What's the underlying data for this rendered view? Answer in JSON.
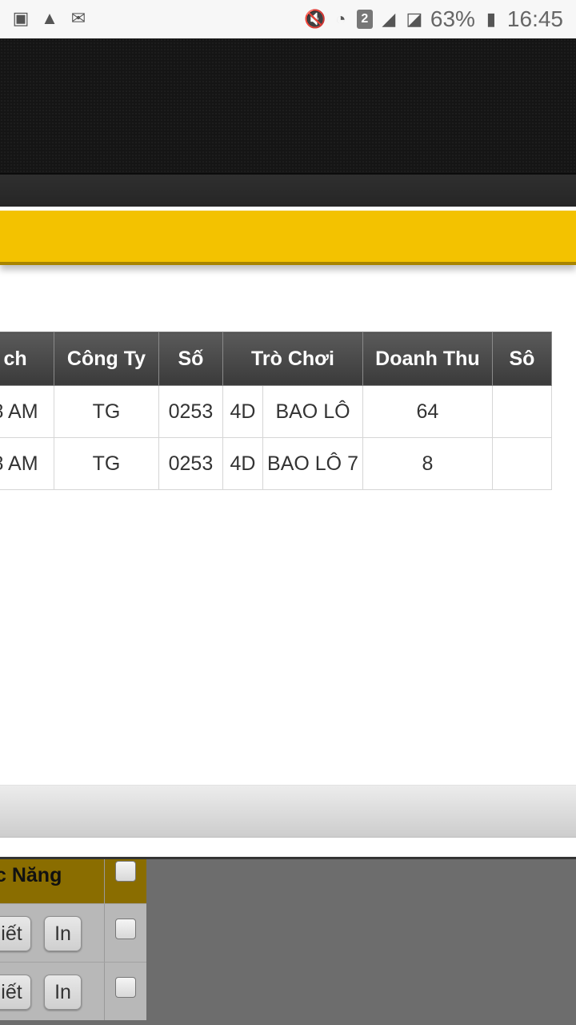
{
  "status_bar": {
    "icons_left": [
      "image-icon",
      "warning-icon",
      "mail-icon"
    ],
    "sim_slot": "2",
    "battery": "63%",
    "time": "16:45"
  },
  "table": {
    "headers": [
      "ch",
      "Công Ty",
      "Số",
      "Trò Chơi",
      "Doanh Thu",
      "Sô"
    ],
    "rows": [
      {
        "time": "8 AM",
        "company": "TG",
        "number": "0253",
        "game_type": "4D",
        "game": "BAO LÔ",
        "revenue": "64"
      },
      {
        "time": "8 AM",
        "company": "TG",
        "number": "0253",
        "game_type": "4D",
        "game": "BAO LÔ 7",
        "revenue": "8"
      }
    ]
  },
  "overlay": {
    "header_label": "c Năng",
    "rows": [
      {
        "detail_label": "iết",
        "print_label": "In"
      },
      {
        "detail_label": "iết",
        "print_label": "In"
      }
    ]
  }
}
